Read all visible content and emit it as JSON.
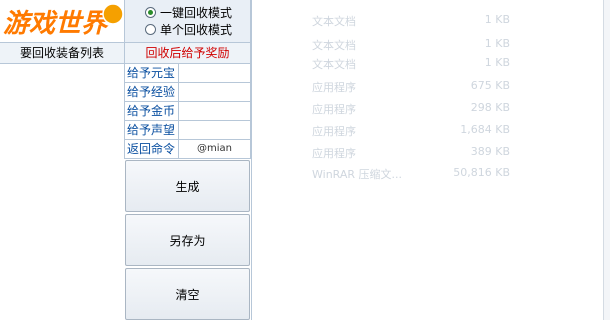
{
  "logo": {
    "text": "游戏世界",
    "badge": "",
    "primary_color": "#ff7a00",
    "outline_color": "#ffffff",
    "badge_color": "#f5a000"
  },
  "mode": {
    "options": [
      {
        "label": "一键回收模式",
        "checked": true
      },
      {
        "label": "单个回收模式",
        "checked": false
      }
    ]
  },
  "list": {
    "header": "要回收装备列表"
  },
  "reward": {
    "header": "回收后给予奖励",
    "header_color": "#d00000",
    "rows": [
      {
        "label": "给予元宝",
        "value": ""
      },
      {
        "label": "给予经验",
        "value": ""
      },
      {
        "label": "给予金币",
        "value": ""
      },
      {
        "label": "给予声望",
        "value": ""
      },
      {
        "label": "返回命令",
        "value": "@mian"
      }
    ]
  },
  "buttons": {
    "generate": "生成",
    "save_as": "另存为",
    "clear": "清空"
  },
  "ghost": {
    "rows": [
      {
        "type": "文本文档",
        "size": "1 KB"
      },
      {
        "type": "文本文档",
        "size": "1 KB"
      },
      {
        "type": "文本文档",
        "size": "1 KB"
      },
      {
        "type": "应用程序",
        "size": "675 KB"
      },
      {
        "type": "应用程序",
        "size": "298 KB"
      },
      {
        "type": "应用程序",
        "size": "1,684 KB"
      },
      {
        "type": "应用程序",
        "size": "389 KB"
      },
      {
        "type": "WinRAR 压缩文...",
        "size": "50,816 KB"
      }
    ]
  }
}
